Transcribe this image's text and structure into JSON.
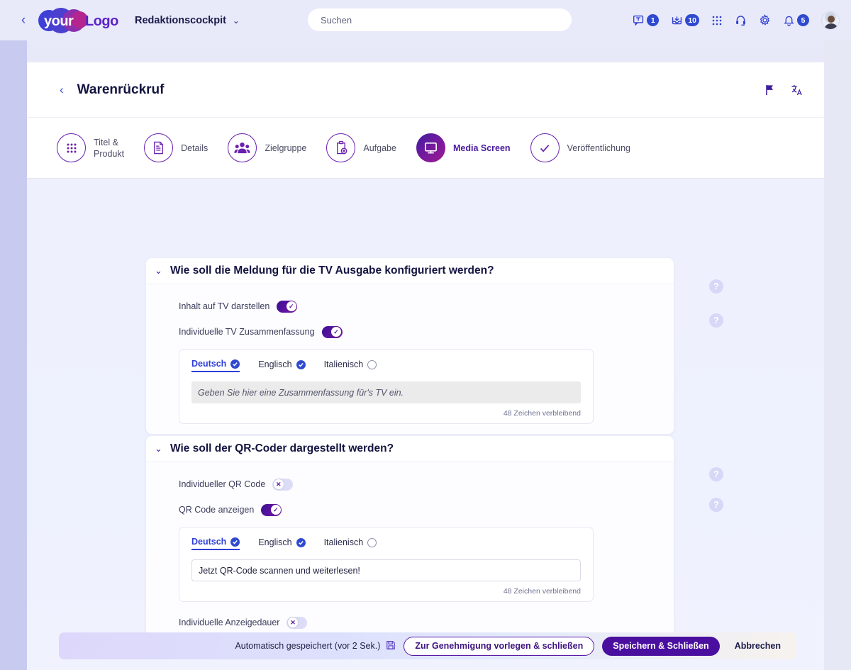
{
  "topbar": {
    "back_icon": "chevron-left-icon",
    "logo": {
      "word1": "your",
      "word2": "Logo"
    },
    "app_menu": {
      "label": "Redaktionscockpit",
      "chevron": "⌄"
    },
    "search": {
      "placeholder": "Suchen",
      "value": ""
    },
    "icons": [
      {
        "name": "messages-icon",
        "badge": "1"
      },
      {
        "name": "inbox-icon",
        "badge": "10"
      },
      {
        "name": "apps-grid-icon",
        "badge": ""
      },
      {
        "name": "support-headset-icon",
        "badge": ""
      },
      {
        "name": "settings-gear-icon",
        "badge": ""
      },
      {
        "name": "notifications-bell-icon",
        "badge": "5"
      }
    ],
    "avatar": "user-avatar"
  },
  "page": {
    "back_icon": "chevron-left-icon",
    "title": "Warenrückruf",
    "actions": [
      {
        "name": "flag-icon"
      },
      {
        "name": "translate-icon"
      }
    ]
  },
  "stepper": {
    "steps": [
      {
        "label": "Titel &\nProdukt",
        "icon": "dots-grid-icon",
        "active": false
      },
      {
        "label": "Details",
        "icon": "document-icon",
        "active": false
      },
      {
        "label": "Zielgruppe",
        "icon": "people-group-icon",
        "active": false
      },
      {
        "label": "Aufgabe",
        "icon": "clipboard-plus-icon",
        "active": false
      },
      {
        "label": "Media Screen",
        "icon": "monitor-icon",
        "active": true
      },
      {
        "label": "Veröffentlichung",
        "icon": "check-icon",
        "active": false
      }
    ]
  },
  "cards": [
    {
      "title": "Wie soll die Meldung für die TV Ausgabe konfiguriert werden?",
      "collapse_icon": "chevron-down-icon",
      "toggles": [
        {
          "label": "Inhalt auf TV darstellen",
          "state": "on",
          "glyph": "✓"
        },
        {
          "label": "Individuelle TV Zusammenfassung",
          "state": "on",
          "glyph": "✓"
        }
      ],
      "editor": {
        "tabs": [
          {
            "label": "Deutsch",
            "active": true,
            "checked": true
          },
          {
            "label": "Englisch",
            "active": false,
            "checked": true
          },
          {
            "label": "Italienisch",
            "active": false,
            "checked": false
          }
        ],
        "field_type": "disabled",
        "placeholder": "Geben Sie hier eine Zusammenfassung für's TV ein.",
        "value": "",
        "counter": "48 Zeichen verbleibend"
      },
      "footer_toggle": null
    },
    {
      "title": "Wie soll der QR-Coder dargestellt werden?",
      "collapse_icon": "chevron-down-icon",
      "toggles": [
        {
          "label": "Individueller QR Code",
          "state": "off",
          "glyph": "✕"
        },
        {
          "label": "QR Code anzeigen",
          "state": "on",
          "glyph": "✓"
        }
      ],
      "editor": {
        "tabs": [
          {
            "label": "Deutsch",
            "active": true,
            "checked": true
          },
          {
            "label": "Englisch",
            "active": false,
            "checked": true
          },
          {
            "label": "Italienisch",
            "active": false,
            "checked": false
          }
        ],
        "field_type": "text",
        "placeholder": "",
        "value": "Jetzt QR-Code scannen und weiterlesen!",
        "counter": "48 Zeichen verbleibend"
      },
      "footer_toggle": {
        "label": "Individuelle Anzeigedauer",
        "state": "off",
        "glyph": "✕"
      }
    }
  ],
  "help_icons": [
    {
      "name": "help-icon",
      "glyph": "?"
    },
    {
      "name": "help-icon",
      "glyph": "?"
    },
    {
      "name": "help-icon",
      "glyph": "?"
    },
    {
      "name": "help-icon",
      "glyph": "?"
    }
  ],
  "bottombar": {
    "autosave_text": "Automatisch gespeichert (vor 2 Sek.)",
    "autosave_icon": "save-disk-icon",
    "submit_label": "Zur Genehmigung vorlegen & schließen",
    "save_label": "Speichern & Schließen",
    "cancel_label": "Abbrechen"
  },
  "colors": {
    "brand_purple": "#4a0f9e",
    "accent_blue": "#2f4ad0",
    "page_bg": "#eef0fd",
    "sidebar": "#c8caef"
  }
}
